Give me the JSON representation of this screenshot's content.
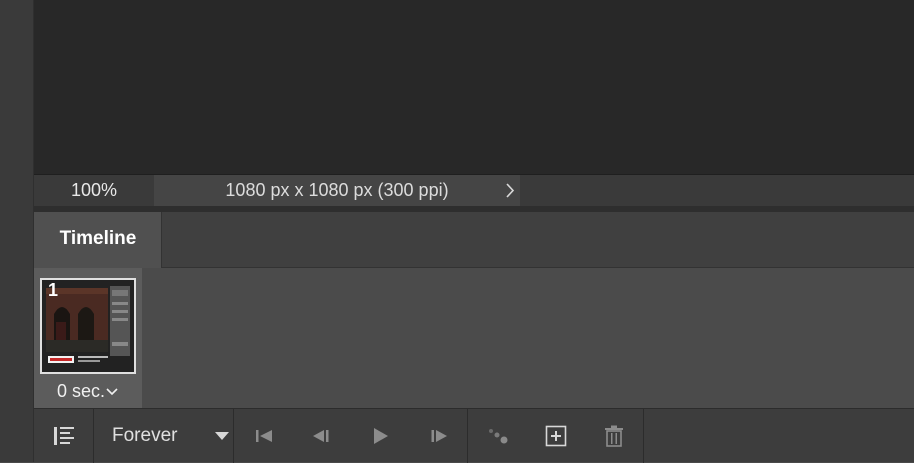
{
  "status_bar": {
    "zoom": "100%",
    "doc_info": "1080 px x 1080 px (300 ppi)"
  },
  "panel": {
    "tab_label": "Timeline"
  },
  "frames": [
    {
      "number": "1",
      "delay": "0 sec."
    }
  ],
  "toolbar": {
    "loop_option": "Forever"
  },
  "icons": {
    "status_more": "chevron-right-icon",
    "delay_menu": "chevron-down-icon",
    "panel_menu": "timeline-menu-icon",
    "loop_menu": "triangle-down-icon",
    "first_frame": "first-frame-icon",
    "prev_frame": "previous-frame-icon",
    "play": "play-icon",
    "next_frame": "next-frame-icon",
    "tween": "tween-icon",
    "duplicate_frame": "add-frame-icon",
    "delete_frame": "trash-icon"
  }
}
